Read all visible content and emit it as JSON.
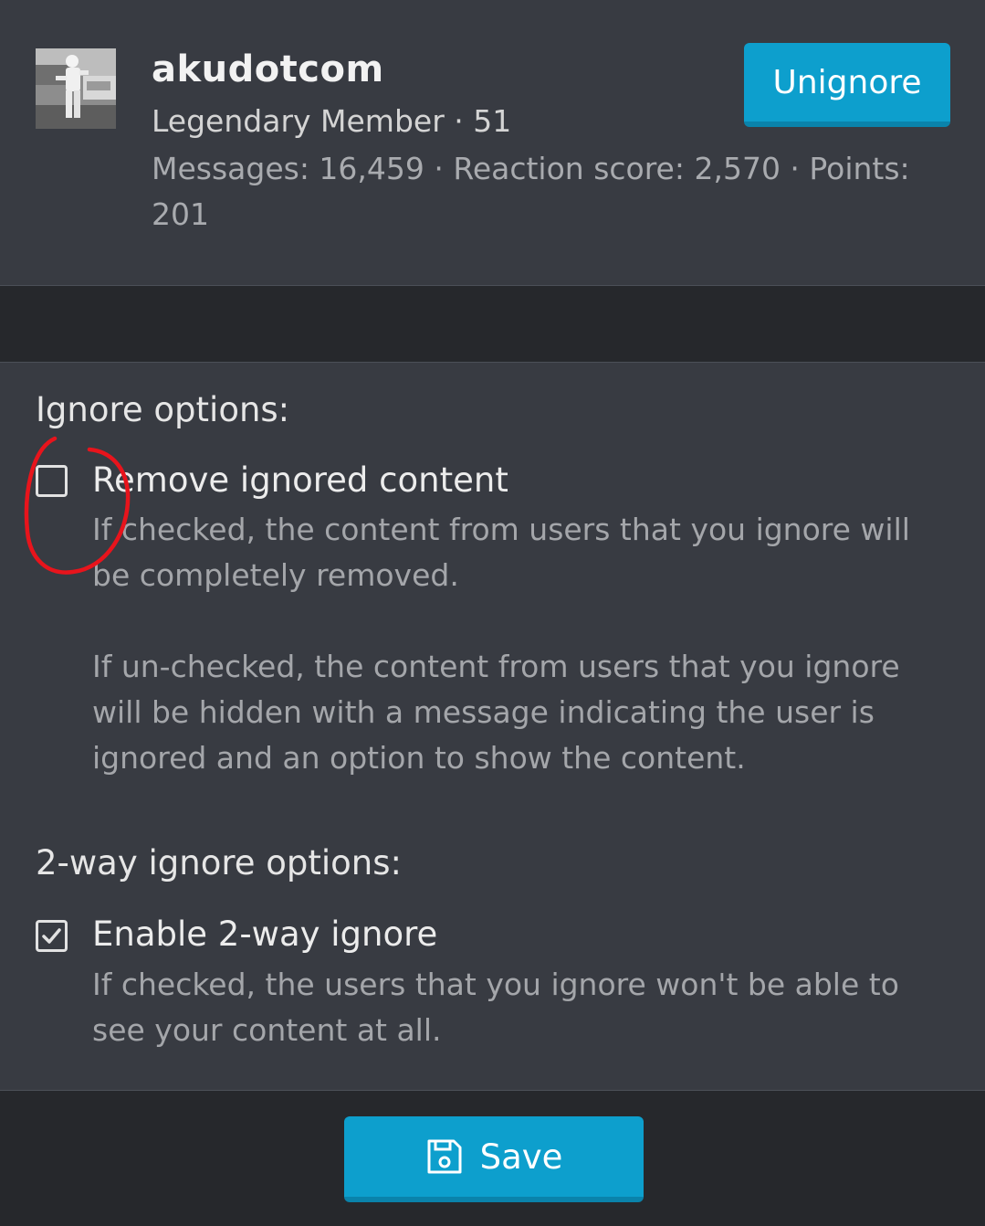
{
  "user": {
    "name": "akudotcom",
    "title_line": "Legendary Member · 51",
    "stats_line": "Messages: 16,459 · Reaction score: 2,570 · Points: 201",
    "avatar_icon": "avatar-photo",
    "unignore_label": "Unignore"
  },
  "options": {
    "ignore_label": "Ignore options:",
    "remove_label": "Remove ignored content",
    "remove_checked": false,
    "remove_hint_1": "If checked, the content from users that you ignore will be completely removed.",
    "remove_hint_2": "If un-checked, the content from users that you ignore will be hidden with a message indicating the user is ignored and an option to show the content.",
    "two_way_label": "2-way ignore options:",
    "enable_two_way_label": "Enable 2-way ignore",
    "enable_two_way_checked": true,
    "enable_two_way_hint": "If checked, the users that you ignore won't be able to see your content at all."
  },
  "footer": {
    "save_label": "Save",
    "save_icon": "floppy-disk-icon"
  },
  "colors": {
    "accent": "#0d9fcd",
    "background": "#383b42",
    "band": "#26282c",
    "annotation": "#e8141c"
  }
}
